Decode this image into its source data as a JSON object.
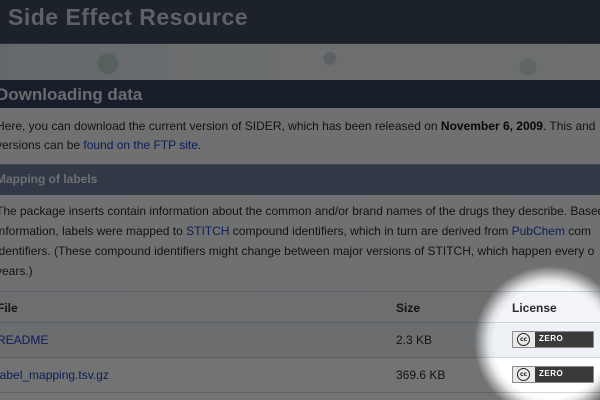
{
  "header": {
    "site_title": "Side Effect Resource"
  },
  "download_section": {
    "heading": "Downloading data",
    "intro_line1_pre": "Here, you can download the current version of SIDER, which has been released on ",
    "intro_line1_bold": "November 6, 2009",
    "intro_line1_post": ". This and",
    "intro_line2_pre": "versions can be ",
    "intro_line2_link": "found on the FTP site",
    "intro_line2_post": "."
  },
  "mapping_section": {
    "heading": "Mapping of labels",
    "line1": "The package inserts contain information about the common and/or brand names of the drugs they describe. Based",
    "line2_pre": "information, labels were mapped to ",
    "line2_link1": "STITCH",
    "line2_mid": " compound identifiers, which in turn are derived from ",
    "line2_link2": "PubChem",
    "line2_post": " com",
    "line3": "identifiers. (These compound identifiers might change between major versions of STITCH, which happen every o",
    "line4": "years.)"
  },
  "table": {
    "columns": [
      "File",
      "Size",
      "License"
    ],
    "rows": [
      {
        "file": "README",
        "size": "2.3 KB",
        "license": "ZERO"
      },
      {
        "file": "label_mapping.tsv.gz",
        "size": "369.6 KB",
        "license": "ZERO"
      }
    ]
  },
  "badge": {
    "cc_text": "cc"
  },
  "colors": {
    "header_bg": "#3f4a5e",
    "section_heading_bg": "#34415c",
    "subheading_bg": "#6c7f9c",
    "link": "#1a3fc4"
  }
}
